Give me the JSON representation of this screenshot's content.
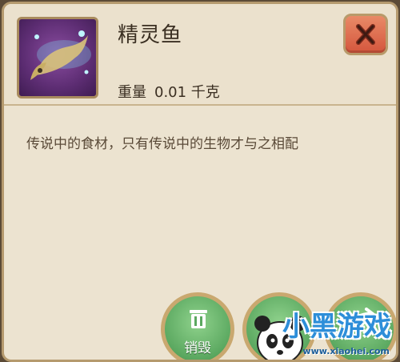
{
  "item": {
    "name": "精灵鱼",
    "weight_label": "重量",
    "weight_value": "0.01 千克",
    "description": "传说中的食材，只有传说中的生物才与之相配"
  },
  "actions": {
    "destroy_label": "销毁"
  },
  "icons": {
    "item": "fairy-fish-icon",
    "close": "close-icon",
    "trash": "trash-icon"
  },
  "watermark": {
    "text": "小黑游戏",
    "url": "www.xiaohei.com"
  },
  "colors": {
    "close": "#d4563d",
    "action": "#5ba860",
    "panel": "#ece3d0"
  }
}
